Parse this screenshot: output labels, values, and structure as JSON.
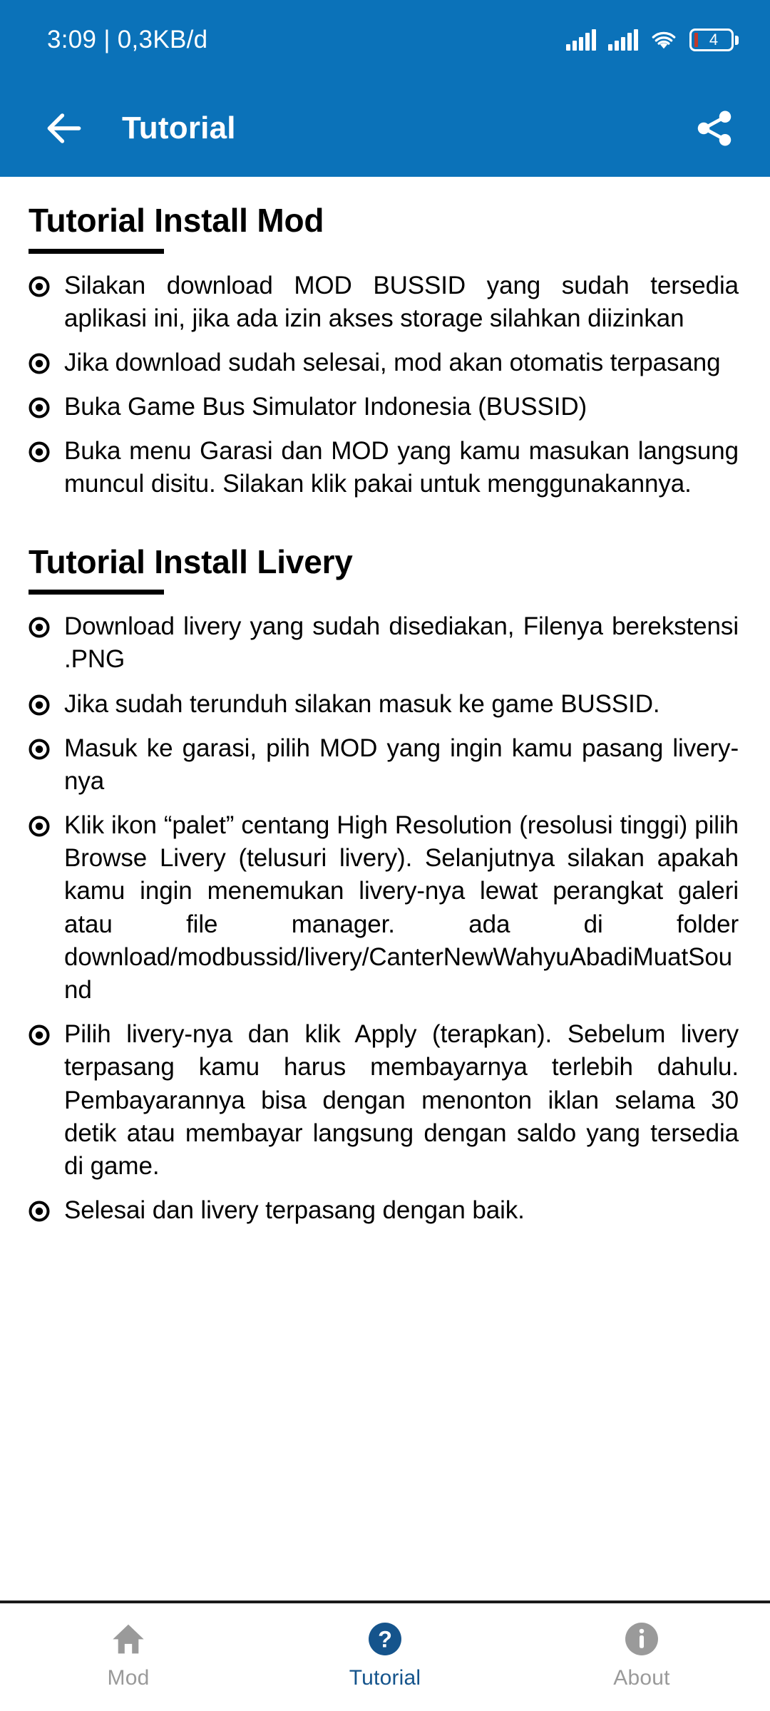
{
  "statusbar": {
    "left_text": "3:09 | 0,3KB/d",
    "battery_level": "4",
    "icons": [
      "signal-bars-icon",
      "signal-bars-icon",
      "wifi-icon",
      "battery-icon"
    ]
  },
  "appbar": {
    "title": "Tutorial",
    "back_icon": "back-arrow-icon",
    "share_icon": "share-icon",
    "background_color": "#0b72b9"
  },
  "content": {
    "sections": [
      {
        "title": "Tutorial Install Mod",
        "items": [
          "Silakan download MOD BUSSID yang sudah tersedia aplikasi ini, jika ada izin akses storage silahkan diizinkan",
          "Jika download sudah selesai, mod akan otomatis terpasang",
          "Buka Game Bus Simulator Indonesia (BUSSID)",
          "Buka menu Garasi dan MOD yang kamu masukan langsung muncul disitu. Silakan klik pakai untuk menggunakannya."
        ]
      },
      {
        "title": "Tutorial Install Livery",
        "items": [
          "Download livery yang sudah disediakan, Filenya berekstensi .PNG",
          "Jika sudah terunduh silakan masuk ke game BUSSID.",
          "Masuk ke garasi, pilih MOD yang ingin kamu pasang livery-nya",
          "Klik ikon “palet” centang High Resolution (resolusi tinggi) pilih Browse Livery (telusuri livery). Selanjutnya silakan apakah kamu ingin menemukan livery-nya lewat perangkat galeri atau file manager. ada di folder download/modbussid/livery/CanterNewWahyuAbadiMuatSound",
          "Pilih livery-nya dan klik Apply (terapkan). Sebelum livery terpasang kamu harus membayarnya terlebih dahulu. Pembayarannya bisa dengan menonton iklan selama 30 detik atau membayar langsung dengan saldo yang tersedia di game.",
          "Selesai dan livery terpasang dengan baik."
        ]
      }
    ]
  },
  "bottomnav": {
    "active_color": "#15548c",
    "inactive_color": "#9a9a9a",
    "items": [
      {
        "label": "Mod",
        "icon": "home-icon",
        "active": false
      },
      {
        "label": "Tutorial",
        "icon": "help-circle-icon",
        "active": true
      },
      {
        "label": "About",
        "icon": "info-circle-icon",
        "active": false
      }
    ]
  }
}
